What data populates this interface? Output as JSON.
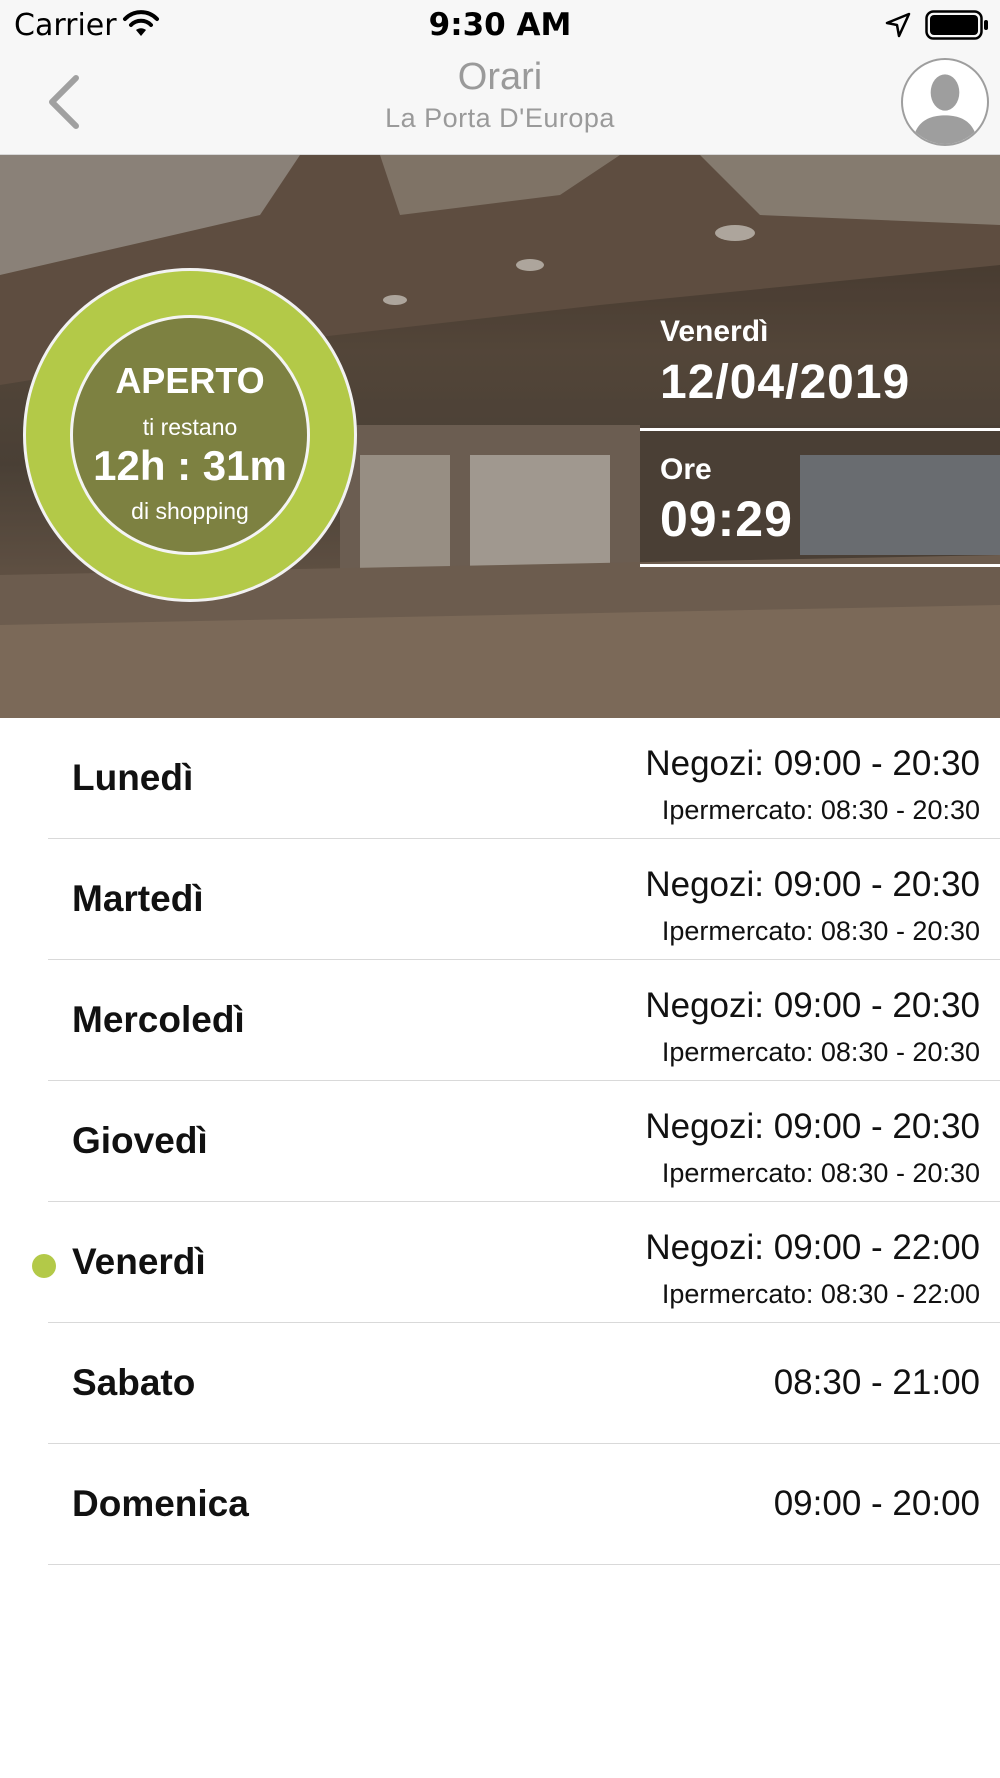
{
  "status_bar": {
    "carrier": "Carrier",
    "time": "9:30 AM",
    "icons": [
      "wifi-icon",
      "location-arrow-icon",
      "battery-icon"
    ]
  },
  "nav": {
    "back_icon": "chevron-left-icon",
    "title": "Orari",
    "subtitle": "La Porta D'Europa",
    "avatar_icon": "user-silhouette-icon"
  },
  "hero": {
    "status": "APERTO",
    "remaining_prefix": "ti restano",
    "remaining_time": "12h : 31m",
    "remaining_suffix": "di shopping",
    "day_label": "Venerdì",
    "date": "12/04/2019",
    "time_label": "Ore",
    "time": "09:29",
    "accent_color": "#b3c948"
  },
  "schedule": [
    {
      "day": "Lunedì",
      "shops": "Negozi: 09:00 - 20:30",
      "hypermarket": "Ipermercato: 08:30 - 20:30",
      "today": false
    },
    {
      "day": "Martedì",
      "shops": "Negozi: 09:00 - 20:30",
      "hypermarket": "Ipermercato: 08:30 - 20:30",
      "today": false
    },
    {
      "day": "Mercoledì",
      "shops": "Negozi: 09:00 - 20:30",
      "hypermarket": "Ipermercato: 08:30 - 20:30",
      "today": false
    },
    {
      "day": "Giovedì",
      "shops": "Negozi: 09:00 - 20:30",
      "hypermarket": "Ipermercato: 08:30 - 20:30",
      "today": false
    },
    {
      "day": "Venerdì",
      "shops": "Negozi: 09:00 - 22:00",
      "hypermarket": "Ipermercato: 08:30 - 22:00",
      "today": true
    },
    {
      "day": "Sabato",
      "hours": "08:30 - 21:00",
      "today": false
    },
    {
      "day": "Domenica",
      "hours": "09:00 - 20:00",
      "today": false
    }
  ]
}
